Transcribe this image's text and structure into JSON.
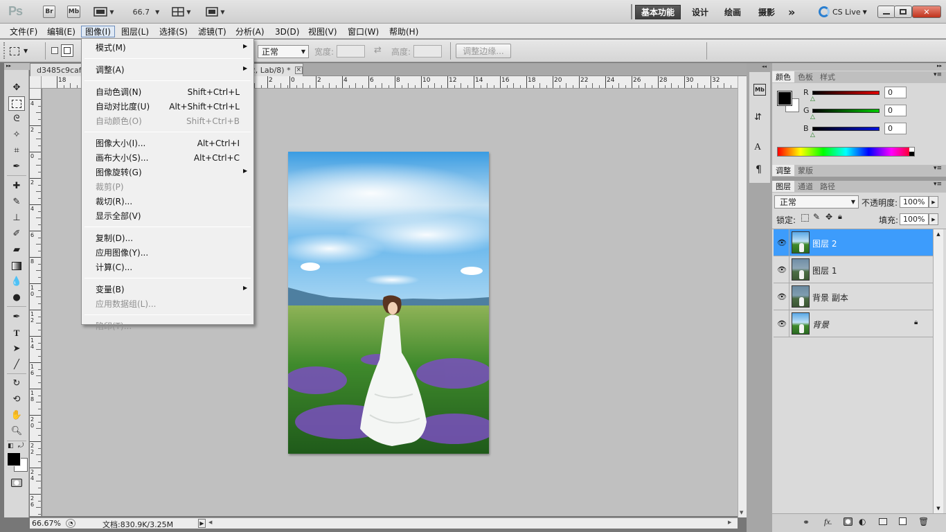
{
  "titlebar": {
    "logo": "Ps",
    "br_label": "Br",
    "mb_label": "Mb",
    "zoom": "66.7",
    "workspaces": [
      "基本功能",
      "设计",
      "绘画",
      "摄影"
    ],
    "more": "»",
    "cslive": "CS Live"
  },
  "menubar": [
    "文件(F)",
    "编辑(E)",
    "图像(I)",
    "图层(L)",
    "选择(S)",
    "滤镜(T)",
    "分析(A)",
    "3D(D)",
    "视图(V)",
    "窗口(W)",
    "帮助(H)"
  ],
  "options": {
    "mode_value": "正常",
    "width_label": "宽度:",
    "height_label": "高度:",
    "refine_edge": "调整边缘..."
  },
  "doc": {
    "tab_title": "d3485c9cafc",
    "tab_title_suffix": "2, Lab/8) *",
    "close": "×",
    "zoom_status": "66.67%",
    "doc_status": "文档:830.9K/3.25M"
  },
  "ruler": {
    "h_ticks": [
      "18",
      "16",
      "14",
      "12",
      "10",
      "8",
      "6",
      "4",
      "2",
      "0",
      "2",
      "4",
      "6",
      "8",
      "10",
      "12",
      "14",
      "16",
      "18",
      "20",
      "22",
      "24",
      "26",
      "28",
      "30",
      "32"
    ],
    "v_ticks": [
      "4",
      "2",
      "0",
      "2",
      "4",
      "6",
      "8",
      "10",
      "12",
      "14",
      "16",
      "18",
      "20",
      "22",
      "24",
      "26"
    ]
  },
  "image_menu": {
    "items": [
      {
        "label": "模式(M)",
        "shortcut": "",
        "submenu": true,
        "disabled": false
      },
      {
        "sep": true
      },
      {
        "label": "调整(A)",
        "shortcut": "",
        "submenu": true,
        "disabled": false
      },
      {
        "sep": true
      },
      {
        "label": "自动色调(N)",
        "shortcut": "Shift+Ctrl+L",
        "submenu": false,
        "disabled": false
      },
      {
        "label": "自动对比度(U)",
        "shortcut": "Alt+Shift+Ctrl+L",
        "submenu": false,
        "disabled": false
      },
      {
        "label": "自动颜色(O)",
        "shortcut": "Shift+Ctrl+B",
        "submenu": false,
        "disabled": true
      },
      {
        "sep": true
      },
      {
        "label": "图像大小(I)...",
        "shortcut": "Alt+Ctrl+I",
        "submenu": false,
        "disabled": false
      },
      {
        "label": "画布大小(S)...",
        "shortcut": "Alt+Ctrl+C",
        "submenu": false,
        "disabled": false
      },
      {
        "label": "图像旋转(G)",
        "shortcut": "",
        "submenu": true,
        "disabled": false
      },
      {
        "label": "裁剪(P)",
        "shortcut": "",
        "submenu": false,
        "disabled": true
      },
      {
        "label": "裁切(R)...",
        "shortcut": "",
        "submenu": false,
        "disabled": false
      },
      {
        "label": "显示全部(V)",
        "shortcut": "",
        "submenu": false,
        "disabled": false
      },
      {
        "sep": true
      },
      {
        "label": "复制(D)...",
        "shortcut": "",
        "submenu": false,
        "disabled": false
      },
      {
        "label": "应用图像(Y)...",
        "shortcut": "",
        "submenu": false,
        "disabled": false
      },
      {
        "label": "计算(C)...",
        "shortcut": "",
        "submenu": false,
        "disabled": false
      },
      {
        "sep": true
      },
      {
        "label": "变量(B)",
        "shortcut": "",
        "submenu": true,
        "disabled": false
      },
      {
        "label": "应用数据组(L)...",
        "shortcut": "",
        "submenu": false,
        "disabled": true
      },
      {
        "sep": true
      },
      {
        "label": "陷印(T)...",
        "shortcut": "",
        "submenu": false,
        "disabled": true
      }
    ]
  },
  "color_panel": {
    "tabs": [
      "颜色",
      "色板",
      "样式"
    ],
    "channels": [
      {
        "label": "R",
        "value": "0",
        "color": "#e00000"
      },
      {
        "label": "G",
        "value": "0",
        "color": "#00c800"
      },
      {
        "label": "B",
        "value": "0",
        "color": "#0010e0"
      }
    ]
  },
  "adjust_panel": {
    "tabs": [
      "调整",
      "蒙版"
    ]
  },
  "layers_panel": {
    "tabs": [
      "图层",
      "通道",
      "路径"
    ],
    "blend_mode": "正常",
    "opacity_label": "不透明度:",
    "opacity_value": "100%",
    "lock_label": "锁定:",
    "fill_label": "填充:",
    "fill_value": "100%",
    "layers": [
      {
        "name": "图层 2",
        "selected": true,
        "locked": false
      },
      {
        "name": "图层 1",
        "selected": false,
        "locked": false
      },
      {
        "name": "背景 副本",
        "selected": false,
        "locked": false
      },
      {
        "name": "背景",
        "selected": false,
        "locked": true
      }
    ]
  },
  "colors": {
    "selection_blue": "#3d9cfc",
    "menu_bg": "#f0f0f0",
    "canvas_bg": "#c0c0c0"
  }
}
